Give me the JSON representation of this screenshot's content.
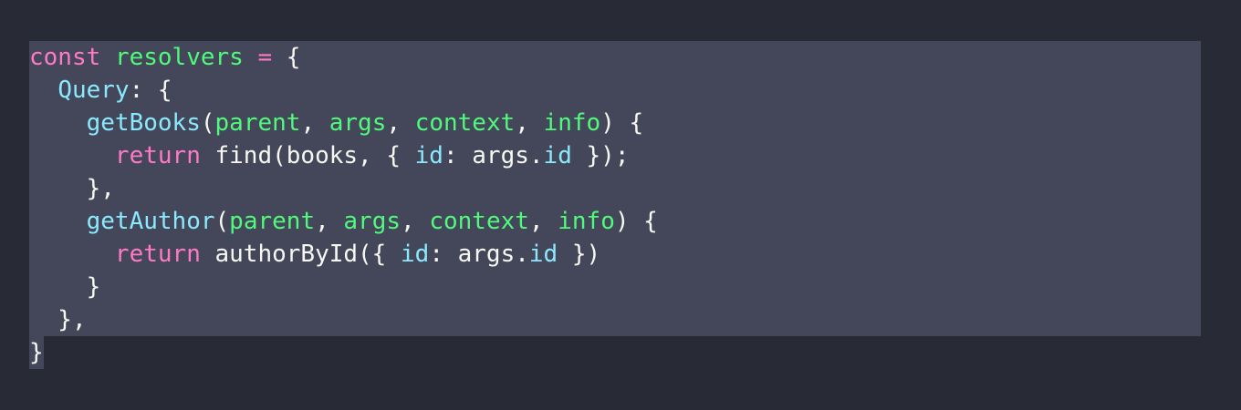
{
  "colors": {
    "background": "#282a36",
    "selection": "#44475a",
    "foreground": "#f8f8f2",
    "keyword": "#ff79c6",
    "definition": "#50fa7b",
    "type": "#8be9fd",
    "parameter": "#50fa7b",
    "property": "#8be9fd"
  },
  "lines": [
    [
      {
        "cls": "kw",
        "text": "const"
      },
      {
        "cls": "plain",
        "text": " "
      },
      {
        "cls": "def",
        "text": "resolvers"
      },
      {
        "cls": "plain",
        "text": " "
      },
      {
        "cls": "kw",
        "text": "="
      },
      {
        "cls": "plain",
        "text": " {"
      }
    ],
    [
      {
        "cls": "plain",
        "text": "  "
      },
      {
        "cls": "type",
        "text": "Query"
      },
      {
        "cls": "plain",
        "text": ": {"
      }
    ],
    [
      {
        "cls": "plain",
        "text": "    "
      },
      {
        "cls": "fn",
        "text": "getBooks"
      },
      {
        "cls": "plain",
        "text": "("
      },
      {
        "cls": "param",
        "text": "parent"
      },
      {
        "cls": "plain",
        "text": ", "
      },
      {
        "cls": "param",
        "text": "args"
      },
      {
        "cls": "plain",
        "text": ", "
      },
      {
        "cls": "param",
        "text": "context"
      },
      {
        "cls": "plain",
        "text": ", "
      },
      {
        "cls": "param",
        "text": "info"
      },
      {
        "cls": "plain",
        "text": ") {"
      }
    ],
    [
      {
        "cls": "plain",
        "text": "      "
      },
      {
        "cls": "kw",
        "text": "return"
      },
      {
        "cls": "plain",
        "text": " find(books, { "
      },
      {
        "cls": "prop",
        "text": "id"
      },
      {
        "cls": "plain",
        "text": ": args."
      },
      {
        "cls": "prop",
        "text": "id"
      },
      {
        "cls": "plain",
        "text": " });"
      }
    ],
    [
      {
        "cls": "plain",
        "text": "    },"
      }
    ],
    [
      {
        "cls": "plain",
        "text": "    "
      },
      {
        "cls": "fn",
        "text": "getAuthor"
      },
      {
        "cls": "plain",
        "text": "("
      },
      {
        "cls": "param",
        "text": "parent"
      },
      {
        "cls": "plain",
        "text": ", "
      },
      {
        "cls": "param",
        "text": "args"
      },
      {
        "cls": "plain",
        "text": ", "
      },
      {
        "cls": "param",
        "text": "context"
      },
      {
        "cls": "plain",
        "text": ", "
      },
      {
        "cls": "param",
        "text": "info"
      },
      {
        "cls": "plain",
        "text": ") {"
      }
    ],
    [
      {
        "cls": "plain",
        "text": "      "
      },
      {
        "cls": "kw",
        "text": "return"
      },
      {
        "cls": "plain",
        "text": " authorById({ "
      },
      {
        "cls": "prop",
        "text": "id"
      },
      {
        "cls": "plain",
        "text": ": args."
      },
      {
        "cls": "prop",
        "text": "id"
      },
      {
        "cls": "plain",
        "text": " })"
      }
    ],
    [
      {
        "cls": "plain",
        "text": "    }"
      }
    ],
    [
      {
        "cls": "plain",
        "text": "  },"
      }
    ],
    [
      {
        "cls": "plain",
        "text": "}"
      }
    ]
  ]
}
